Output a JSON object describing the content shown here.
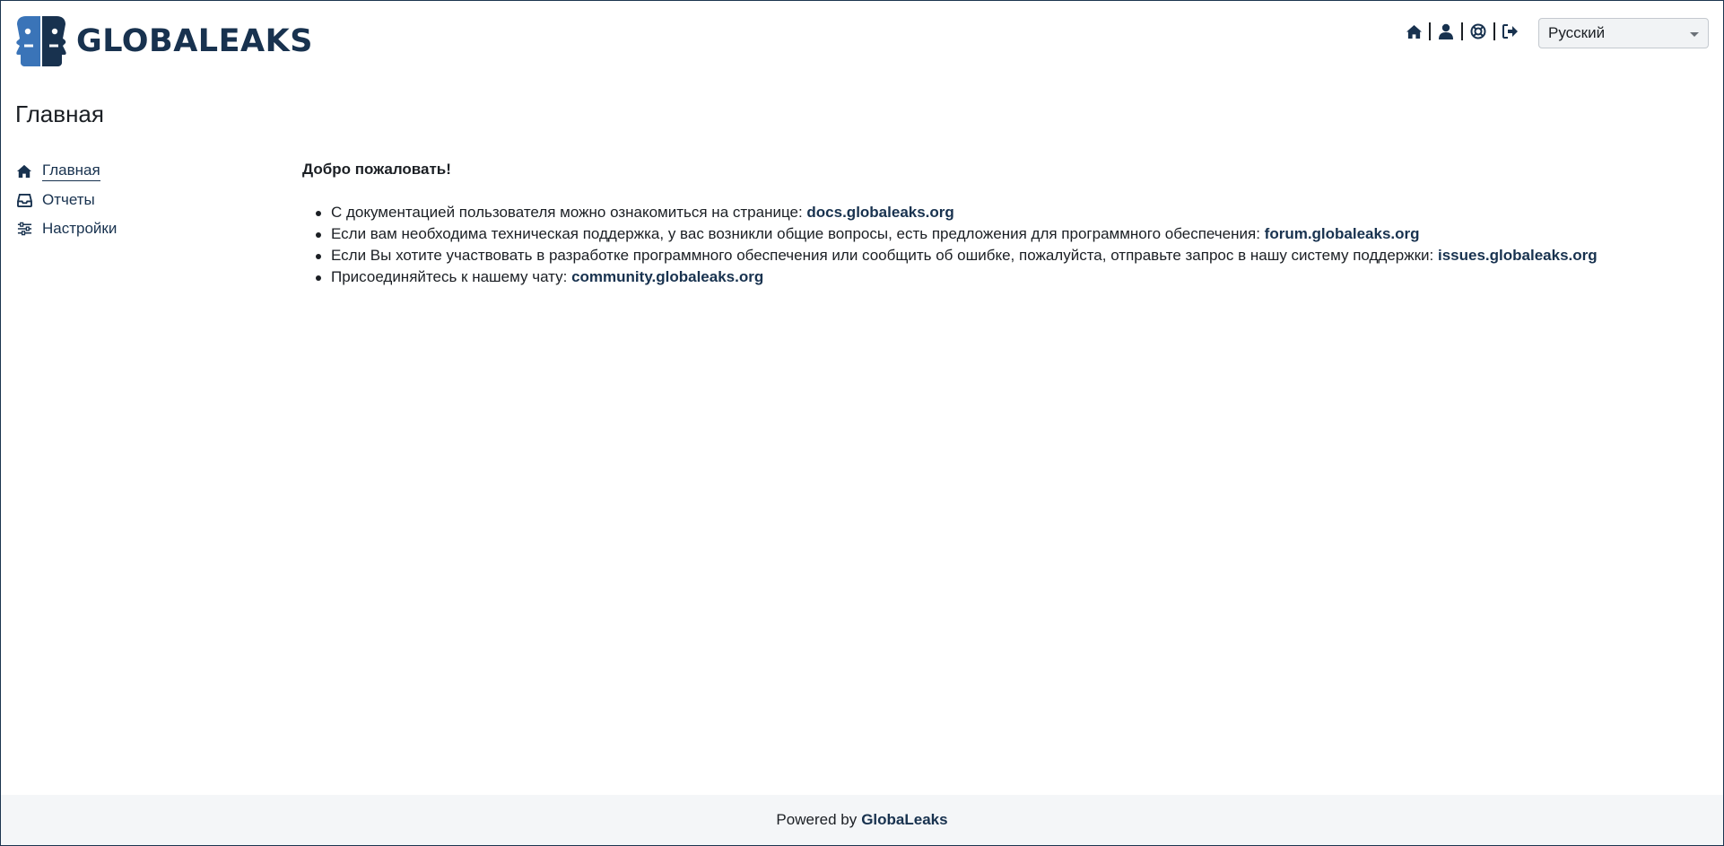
{
  "header": {
    "logo_text": "GLOBALEAKS",
    "nav_icons": [
      "home-icon",
      "user-icon",
      "help-lifebuoy-icon",
      "logout-icon"
    ],
    "language": "Русский"
  },
  "page": {
    "title": "Главная"
  },
  "sidebar": {
    "items": [
      {
        "label": "Главная",
        "icon": "home-icon",
        "active": true
      },
      {
        "label": "Отчеты",
        "icon": "inbox-icon",
        "active": false
      },
      {
        "label": "Настройки",
        "icon": "sliders-icon",
        "active": false
      }
    ]
  },
  "main": {
    "welcome": "Добро пожаловать!",
    "items": [
      {
        "text": "С документацией пользователя можно ознакомиться на странице: ",
        "link": "docs.globaleaks.org"
      },
      {
        "text": "Если вам необходима техническая поддержка, у вас возникли общие вопросы, есть предложения для программного обеспечения: ",
        "link": "forum.globaleaks.org"
      },
      {
        "text": "Если Вы хотите участвовать в разработке программного обеспечения или сообщить об ошибке, пожалуйста, отправьте запрос в нашу систему поддержки: ",
        "link": "issues.globaleaks.org"
      },
      {
        "text": "Присоединяйтесь к нашему чату: ",
        "link": "community.globaleaks.org"
      }
    ]
  },
  "footer": {
    "prefix": "Powered by",
    "link": "GlobaLeaks"
  },
  "colors": {
    "brand": "#18324f",
    "logo_blue": "#3a74b8",
    "footer_bg": "#f4f6f8"
  }
}
